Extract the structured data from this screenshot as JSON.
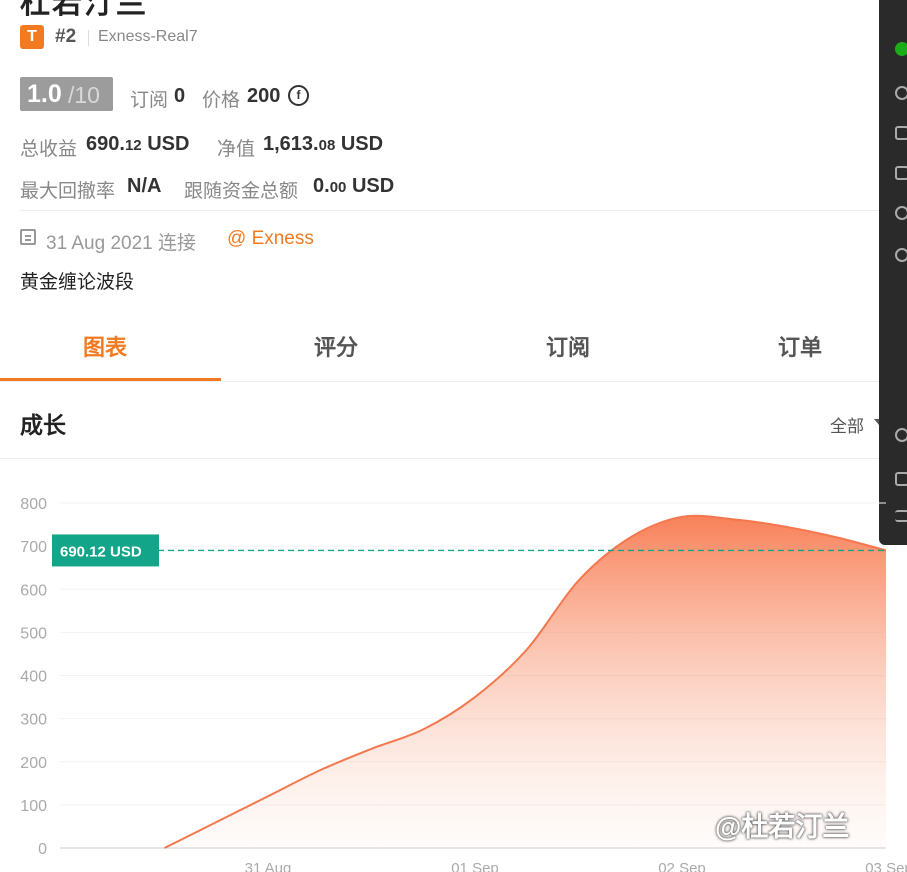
{
  "header": {
    "title": "杜若汀兰",
    "badge_letter": "T",
    "rank": "#2",
    "server": "Exness-Real7"
  },
  "score": {
    "main": "1.0",
    "sub": "/10"
  },
  "stats": {
    "subscribe_label": "订阅",
    "subscribe_value": "0",
    "price_label": "价格",
    "price_value": "200",
    "coin_glyph": "f",
    "total_profit_label": "总收益",
    "total_profit_int": "690.",
    "total_profit_dec": "12",
    "total_profit_unit": "USD",
    "equity_label": "净值",
    "equity_int": "1,613.",
    "equity_dec": "08",
    "equity_unit": "USD",
    "max_dd_label": "最大回撤率",
    "max_dd_value": "N/A",
    "follow_label": "跟随资金总额",
    "follow_int": "0.",
    "follow_dec": "00",
    "follow_unit": "USD"
  },
  "info": {
    "date": "31 Aug 2021 连接",
    "broker": "@ Exness",
    "description": "黄金缠论波段"
  },
  "tabs": [
    {
      "label": "图表",
      "active": true
    },
    {
      "label": "评分",
      "active": false
    },
    {
      "label": "订阅",
      "active": false
    },
    {
      "label": "订单",
      "active": false
    }
  ],
  "section": {
    "title": "成长",
    "range_label": "全部"
  },
  "watermark": "@杜若汀兰",
  "colors": {
    "accent": "#f27b21",
    "line": "#f4774d",
    "marker": "#12a589"
  },
  "chart_data": {
    "type": "area",
    "ylim": [
      0,
      800
    ],
    "yticks": [
      "800",
      "700",
      "600",
      "500",
      "400",
      "300",
      "200",
      "100",
      "0"
    ],
    "xticks": [
      "31 Aug",
      "01 Sep",
      "02 Sep",
      "03 Sep"
    ],
    "x": [
      -0.5,
      -0.25,
      0,
      0.25,
      0.5,
      0.75,
      1.0,
      1.25,
      1.5,
      1.75,
      2.0,
      2.25,
      2.5,
      2.75,
      3.0
    ],
    "values": [
      0,
      60,
      120,
      180,
      230,
      275,
      350,
      460,
      620,
      720,
      768,
      762,
      745,
      720,
      690
    ],
    "marker_label": "690.12 USD",
    "marker_value": 690
  }
}
